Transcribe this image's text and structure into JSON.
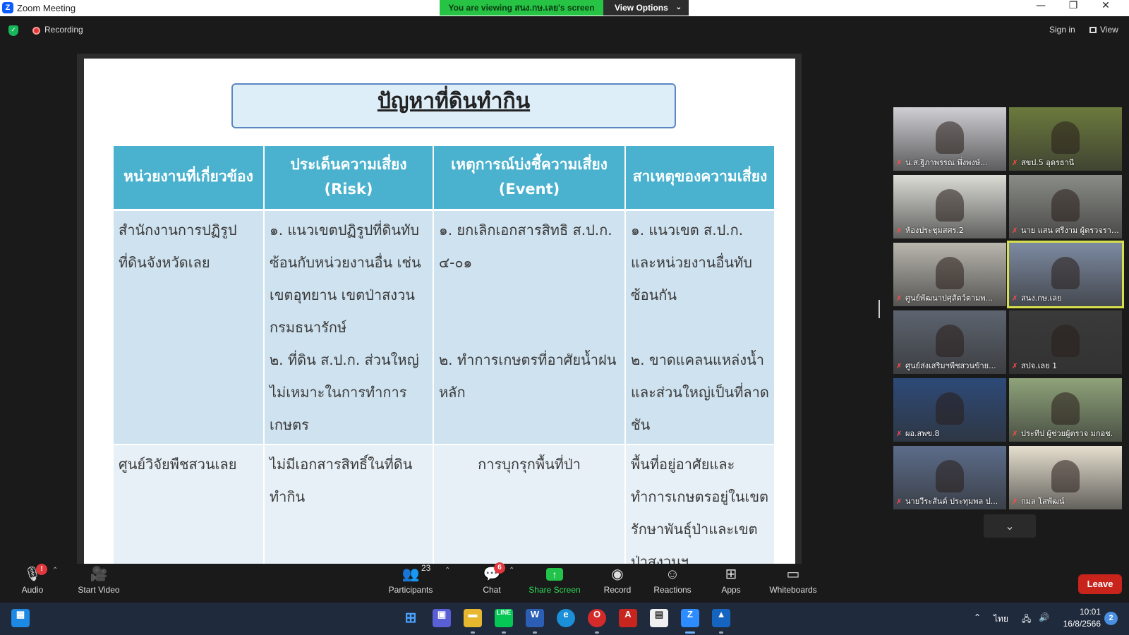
{
  "window": {
    "title": "Zoom Meeting",
    "viewing_banner": "You are viewing สนง.กษ.เลย's screen",
    "view_options_label": "View Options",
    "minimize": "—",
    "maximize": "❐",
    "close": "✕"
  },
  "topbar": {
    "recording_label": "Recording",
    "sign_in": "Sign in",
    "view_label": "View"
  },
  "slide": {
    "title": "ปัญหาที่ดินทำกิน",
    "headers": [
      "หน่วยงานที่เกี่ยวข้อง",
      "ประเด็นความเสี่ยง (Risk)",
      "เหตุการณ์บ่งชี้ความเสี่ยง (Event)",
      "สาเหตุของความเสี่ยง"
    ],
    "row1": {
      "agency": "สำนักงานการปฏิรูปที่ดินจังหวัดเลย",
      "risk_1": "๑. แนวเขตปฏิรูปที่ดินทับซ้อนกับหน่วยงานอื่น เช่น เขตอุทยาน เขตป่าสงวน กรมธนารักษ์",
      "risk_2": "๒. ที่ดิน ส.ป.ก. ส่วนใหญ่ไม่เหมาะในการทำการเกษตร",
      "event_1": "๑. ยกเลิกเอกสารสิทธิ ส.ป.ก. ๔-๐๑",
      "event_2": "๒. ทำการเกษตรที่อาศัยน้ำฝนหลัก",
      "cause_1": "๑. แนวเขต ส.ป.ก. และหน่วยงานอื่นทับซ้อนกัน",
      "cause_2": "๒. ขาดแคลนแหล่งน้ำและส่วนใหญ่เป็นที่ลาดชัน"
    },
    "row2": {
      "agency": "ศูนย์วิจัยพืชสวนเลย",
      "risk": "ไม่มีเอกสารสิทธิ์ในที่ดินทำกิน",
      "event": "การบุกรุกพื้นที่ป่า",
      "cause": "พื้นที่อยู่อาศัยและทำการเกษตรอยู่ในเขตรักษาพันธุ์ป่าและเขตป่าสงวนฯ"
    }
  },
  "gallery": {
    "participants": [
      {
        "name": "น.ส.ฐิภาพรรณ พึ่งพงษ์...",
        "scene": "#cfcfd4"
      },
      {
        "name": "สขป.5 อุดรธานี",
        "scene": "#6b7a3c"
      },
      {
        "name": "ห้องประชุมสศร.2",
        "scene": "#dcdcd6"
      },
      {
        "name": "นาย แสน ศรีงาม ผู้ตรวจราช...",
        "scene": "#8a8c86"
      },
      {
        "name": "ศูนย์พัฒนาปศุสัตว์ตามพ...",
        "scene": "#b9b6ae"
      },
      {
        "name": "สนง.กษ.เลย",
        "scene": "#7c8aa1"
      },
      {
        "name": "ศูนย์ส่งเสริมฯพืชสวนข้าย...",
        "scene": "#5d6470"
      },
      {
        "name": "สปจ.เลย 1",
        "scene": "#3a3a3a"
      },
      {
        "name": "ผอ.สพข.8",
        "scene": "#2d4a78"
      },
      {
        "name": "ประทีป ผู้ช่วยผู้ตรวจ มกอช.",
        "scene": "#8fa37a"
      },
      {
        "name": "นายวีระสันต์ ประทุมพล ป...",
        "scene": "#5b6c8a"
      },
      {
        "name": "กมล โสพัฒน์",
        "scene": "#e6dfcf"
      }
    ]
  },
  "toolbar": {
    "audio": "Audio",
    "start_video": "Start Video",
    "participants": "Participants",
    "participants_count": "23",
    "chat": "Chat",
    "chat_badge": "6",
    "share_screen": "Share Screen",
    "record": "Record",
    "reactions": "Reactions",
    "apps": "Apps",
    "whiteboards": "Whiteboards",
    "leave": "Leave",
    "audio_alert": "!"
  },
  "taskbar": {
    "lang": "ไทย",
    "time": "10:01",
    "date": "16/8/2566",
    "notifications": "2"
  }
}
